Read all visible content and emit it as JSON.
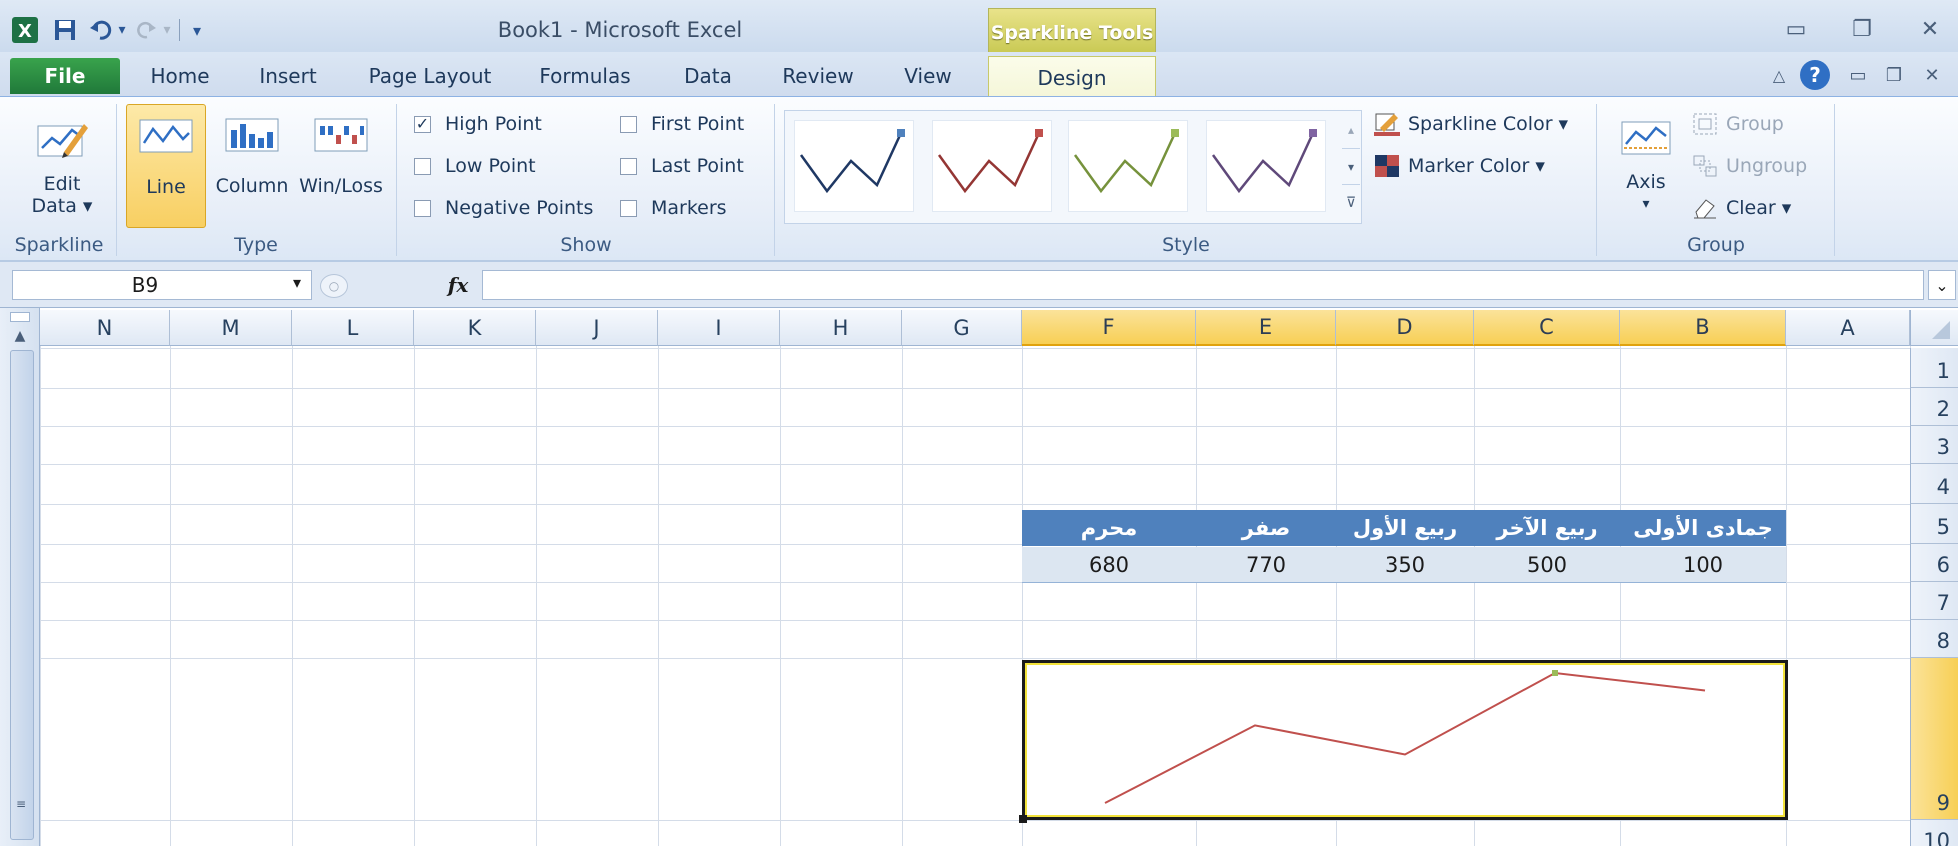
{
  "window": {
    "title": "Book1 - Microsoft Excel",
    "contextual_tab_group": "Sparkline Tools"
  },
  "tabs": {
    "file": "File",
    "home": "Home",
    "insert": "Insert",
    "page_layout": "Page Layout",
    "formulas": "Formulas",
    "data": "Data",
    "review": "Review",
    "view": "View",
    "design": "Design"
  },
  "ribbon": {
    "sparkline": {
      "edit_data_line1": "Edit",
      "edit_data_line2": "Data ▾",
      "group_label": "Sparkline"
    },
    "type": {
      "line": "Line",
      "column": "Column",
      "winloss": "Win/Loss",
      "group_label": "Type"
    },
    "show": {
      "high_point": "High Point",
      "low_point": "Low Point",
      "negative_points": "Negative Points",
      "first_point": "First Point",
      "last_point": "Last Point",
      "markers": "Markers",
      "high_point_checked": true,
      "group_label": "Show"
    },
    "style": {
      "sparkline_color": "Sparkline Color ▾",
      "marker_color": "Marker Color ▾",
      "group_label": "Style",
      "thumb_colors": [
        "#1f3864",
        "#943634",
        "#76923c",
        "#5f497a"
      ],
      "marker_colors": [
        "#4f81bd",
        "#c0504d",
        "#9bbb59",
        "#8064a2"
      ]
    },
    "group": {
      "axis": "Axis",
      "axis_arrow": "▾",
      "group": "Group",
      "ungroup": "Ungroup",
      "clear": "Clear ▾",
      "group_label": "Group"
    }
  },
  "formula_bar": {
    "name_box": "B9",
    "fx": "fx",
    "formula": ""
  },
  "columns": [
    "N",
    "M",
    "L",
    "K",
    "J",
    "I",
    "H",
    "G",
    "F",
    "E",
    "D",
    "C",
    "B",
    "A"
  ],
  "rows": [
    "1",
    "2",
    "3",
    "4",
    "5",
    "6",
    "7",
    "8",
    "9",
    "10"
  ],
  "table": {
    "headers": [
      "محرم",
      "صفر",
      "ربيع الأول",
      "ربيع الآخر",
      "جمادى الأولى"
    ],
    "values": [
      "680",
      "770",
      "350",
      "500",
      "100"
    ]
  },
  "sparkline": {
    "values": [
      100,
      500,
      350,
      770,
      680
    ],
    "line_color": "#c0504d",
    "high_marker_color": "#9bbb59"
  },
  "colors": {
    "accent": "#4f81bd",
    "selection": "#f7cf55"
  }
}
